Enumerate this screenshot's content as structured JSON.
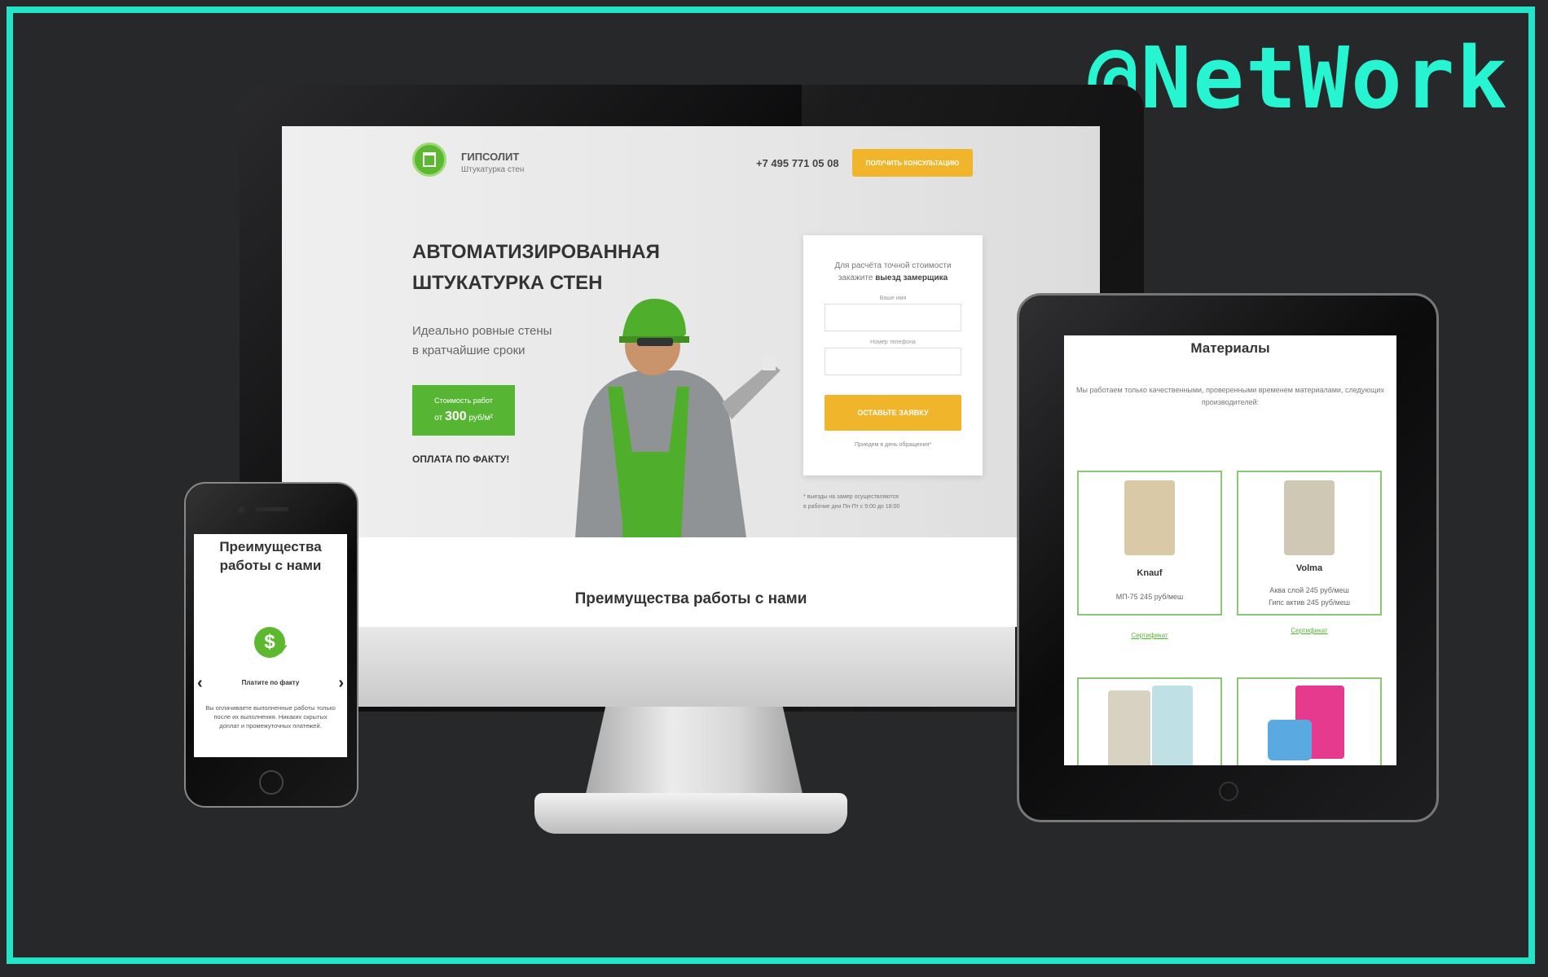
{
  "watermark": "@NetWork",
  "desktop": {
    "logo_title": "ГИПСОЛИТ",
    "logo_subtitle": "Штукатурка стен",
    "phone": "+7 495 771 05 08",
    "consult_button": "ПОЛУЧИТЬ КОНСУЛЬТАЦИЮ",
    "headline_1": "АВТОМАТИЗИРОВАННАЯ",
    "headline_2": "ШТУКАТУРКА СТЕН",
    "subline_1": "Идеально ровные стены",
    "subline_2": "в кратчайшие сроки",
    "price_label": "Стоимость работ",
    "price_from": "от",
    "price_value": "300",
    "price_unit": "руб/м²",
    "pay_fact": "ОПЛАТА ПО ФАКТУ!",
    "form": {
      "title_1": "Для расчёта точной стоимости",
      "title_2": "закажите",
      "title_bold": "выезд замерщика",
      "name_label": "Ваше имя",
      "phone_label": "Номер телефона",
      "submit": "ОСТАВЬТЕ ЗАЯВКУ",
      "note": "Приедем в день обращения*"
    },
    "hours_note_1": "* выезды на замер осуществляются",
    "hours_note_2": "в рабочие дни Пн-Пт с 9:00 до 18:00",
    "advantages_title": "Преимущества работы с нами"
  },
  "tablet": {
    "title": "Материалы",
    "description": "Мы работаем только качественными, проверенными временем материалами, следующих производителей:",
    "materials": [
      {
        "name": "Knauf",
        "price_1": "МП-75 245 руб/меш",
        "price_2": "",
        "cert": "Сертификат",
        "color": "#d9c9a6"
      },
      {
        "name": "Volma",
        "price_1": "Аква слой 245 руб/меш",
        "price_2": "Гипс актив 245 руб/меш",
        "cert": "Сертификат",
        "color": "#cfc8b4"
      },
      {
        "name": "",
        "price_1": "",
        "price_2": "",
        "cert": "",
        "color": "#d8d2c2"
      },
      {
        "name": "",
        "price_1": "",
        "price_2": "",
        "cert": "",
        "color": "#e53a8e"
      }
    ]
  },
  "phone": {
    "title_1": "Преимущества",
    "title_2": "работы с нами",
    "feature": "Платите по факту",
    "text": "Вы оплачиваете выполненные работы только после их выполнения. Никаких скрытых доплат и промежуточных платежей."
  },
  "colors": {
    "accent_green": "#57b534",
    "accent_yellow": "#f0b52a",
    "frame": "#24e3c8"
  }
}
